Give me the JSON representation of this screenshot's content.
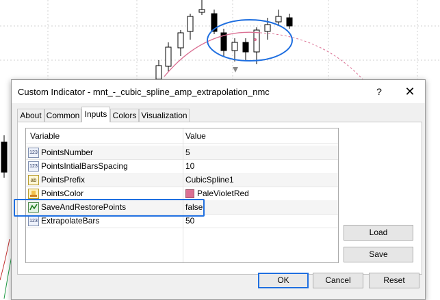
{
  "dialog": {
    "title": "Custom Indicator - mnt_-_cubic_spline_amp_extrapolation_nmc",
    "help_glyph": "?",
    "close_glyph": "✕"
  },
  "tabs": [
    {
      "label": "About"
    },
    {
      "label": "Common"
    },
    {
      "label": "Inputs"
    },
    {
      "label": "Colors"
    },
    {
      "label": "Visualization"
    }
  ],
  "active_tab": "Inputs",
  "grid": {
    "columns": [
      "Variable",
      "Value"
    ],
    "rows": [
      {
        "icon": "123",
        "name": "PointsNumber",
        "value": "5"
      },
      {
        "icon": "123",
        "name": "PointsIntialBarsSpacing",
        "value": "10"
      },
      {
        "icon": "ab",
        "name": "PointsPrefix",
        "value": "CubicSpline1"
      },
      {
        "icon": "color",
        "name": "PointsColor",
        "value": "PaleVioletRed",
        "swatch": "#db7093"
      },
      {
        "icon": "bool",
        "name": "SaveAndRestorePoints",
        "value": "false"
      },
      {
        "icon": "123",
        "name": "ExtrapolateBars",
        "value": "50"
      }
    ]
  },
  "side_buttons": {
    "load": "Load",
    "save": "Save"
  },
  "footer_buttons": {
    "ok": "OK",
    "cancel": "Cancel",
    "reset": "Reset"
  },
  "colors": {
    "accent": "#1f6fe0",
    "spline": "#db7093",
    "annotation": "#1f6fe0"
  }
}
